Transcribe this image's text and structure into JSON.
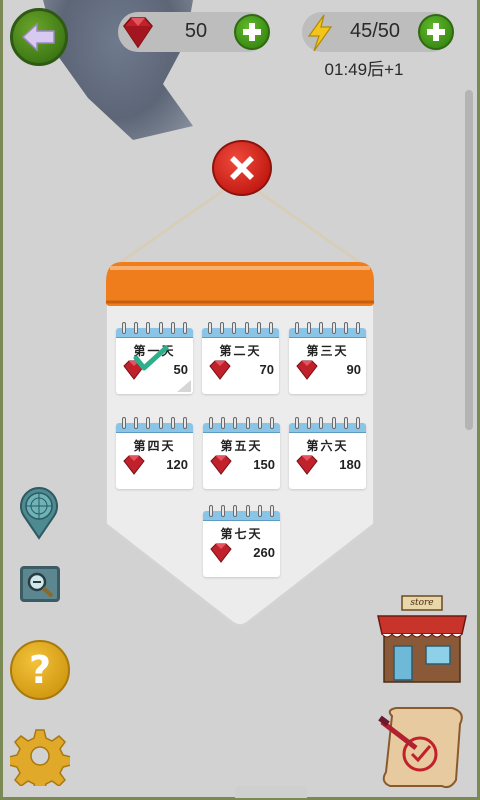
{
  "top_bar": {
    "gems": "50",
    "energy": "45/50",
    "energy_timer": "01:49后+1"
  },
  "store": {
    "sign": "store"
  },
  "help": {
    "label": "?"
  },
  "modal": {
    "days": [
      {
        "label": "第一天",
        "reward": "50",
        "claimed": true
      },
      {
        "label": "第二天",
        "reward": "70",
        "claimed": false
      },
      {
        "label": "第三天",
        "reward": "90",
        "claimed": false
      },
      {
        "label": "第四天",
        "reward": "120",
        "claimed": false
      },
      {
        "label": "第五天",
        "reward": "150",
        "claimed": false
      },
      {
        "label": "第六天",
        "reward": "180",
        "claimed": false
      },
      {
        "label": "第七天",
        "reward": "260",
        "claimed": false
      }
    ]
  },
  "colors": {
    "accent_green": "#3f7a16",
    "close_red": "#c21a12",
    "banner_orange": "#f07d1c",
    "card_header_blue": "#8ac4e6",
    "gem_red": "#c0212b"
  },
  "icons": {
    "back": "arrow-left-icon",
    "gem": "ruby-gem-icon",
    "plus": "plus-icon",
    "energy": "lightning-bolt-icon",
    "close": "close-icon",
    "radar": "radar-pin-icon",
    "zoom": "magnifier-icon",
    "help": "question-mark-icon",
    "settings": "gear-icon",
    "store": "store-building-icon",
    "quest": "scroll-quill-icon",
    "claimed": "checkmark-icon"
  }
}
